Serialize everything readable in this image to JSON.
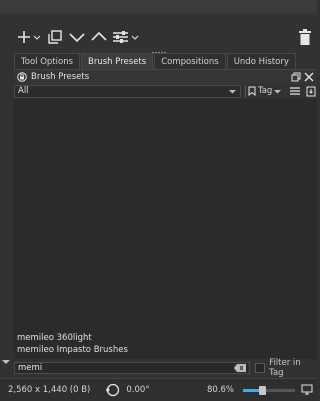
{
  "toolbar": {
    "add_icon": "plus-icon",
    "copy_icon": "copy-icon",
    "down_icon": "chevron-down-icon",
    "up_icon": "chevron-up-icon",
    "settings_icon": "sliders-icon",
    "delete_icon": "trash-icon"
  },
  "tabs": [
    {
      "label": "Tool Options"
    },
    {
      "label": "Brush Presets"
    },
    {
      "label": "Compositions"
    },
    {
      "label": "Undo History"
    }
  ],
  "dock": {
    "title": "Brush Presets",
    "lock_icon": "lock-icon",
    "float_icon": "float-icon",
    "close_icon": "close-icon"
  },
  "filter": {
    "selected": "All",
    "tag_label": "Tag"
  },
  "presets": [
    {
      "name": "memileo 360light"
    },
    {
      "name": "memileo Impasto Brushes"
    }
  ],
  "search": {
    "value": "memi",
    "filter_in_tag_label": "Filter in Tag"
  },
  "status": {
    "image_size": "2,560 x 1,440 (0 B)",
    "rotation": "0.00°",
    "zoom": "80.6%"
  },
  "colors": {
    "background": "#323232",
    "panel": "#2b2b2b",
    "accent": "#3daee9"
  }
}
